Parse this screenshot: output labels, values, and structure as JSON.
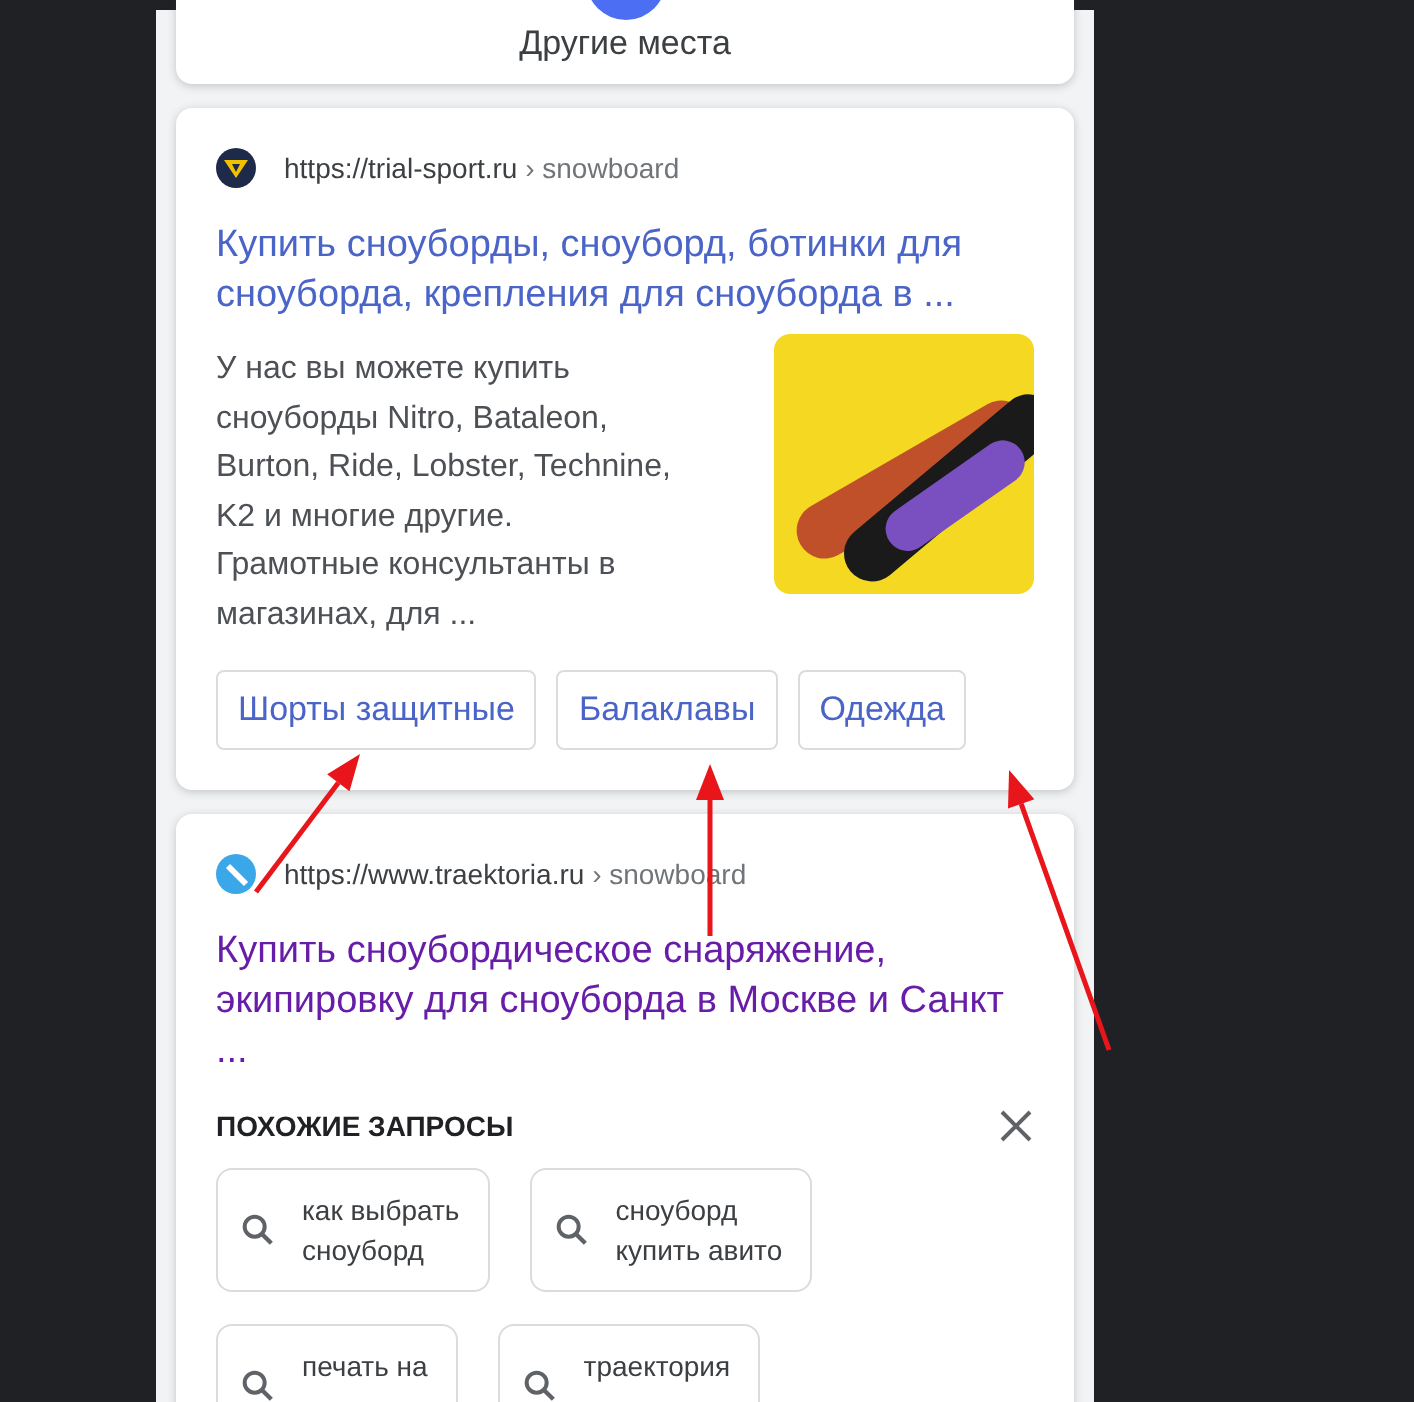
{
  "places_card": {
    "label": "Другие места"
  },
  "results": [
    {
      "kind": "rich",
      "url": "https://trial-sport.ru",
      "path": "› snowboard",
      "title": "Купить сноуборды, сноуборд, ботинки для сноуборда, крепления для сноуборда в ...",
      "visited": false,
      "snippet": "У нас вы можете купить сноуборды Nitro, Bataleon, Burton, Ride, Lobster, Technine, K2 и многие другие. Грамотные консультанты в магазинах, для ...",
      "sitelinks": [
        "Шорты защитные",
        "Балаклавы",
        "Одежда"
      ]
    },
    {
      "kind": "plain",
      "url": "https://www.traektoria.ru",
      "path": "› snowboard",
      "title": "Купить сноубордическое снаряжение, экипировку для сноуборда в Москве и Санкт ...",
      "visited": true
    }
  ],
  "related": {
    "heading": "ПОХОЖИЕ ЗАПРОСЫ",
    "chips": [
      {
        "lines": [
          "как выбрать",
          "сноуборд"
        ]
      },
      {
        "lines": [
          "сноуборд",
          "купить авито"
        ]
      },
      {
        "lines": [
          "печать на"
        ]
      },
      {
        "lines": [
          "траектория"
        ]
      }
    ]
  }
}
